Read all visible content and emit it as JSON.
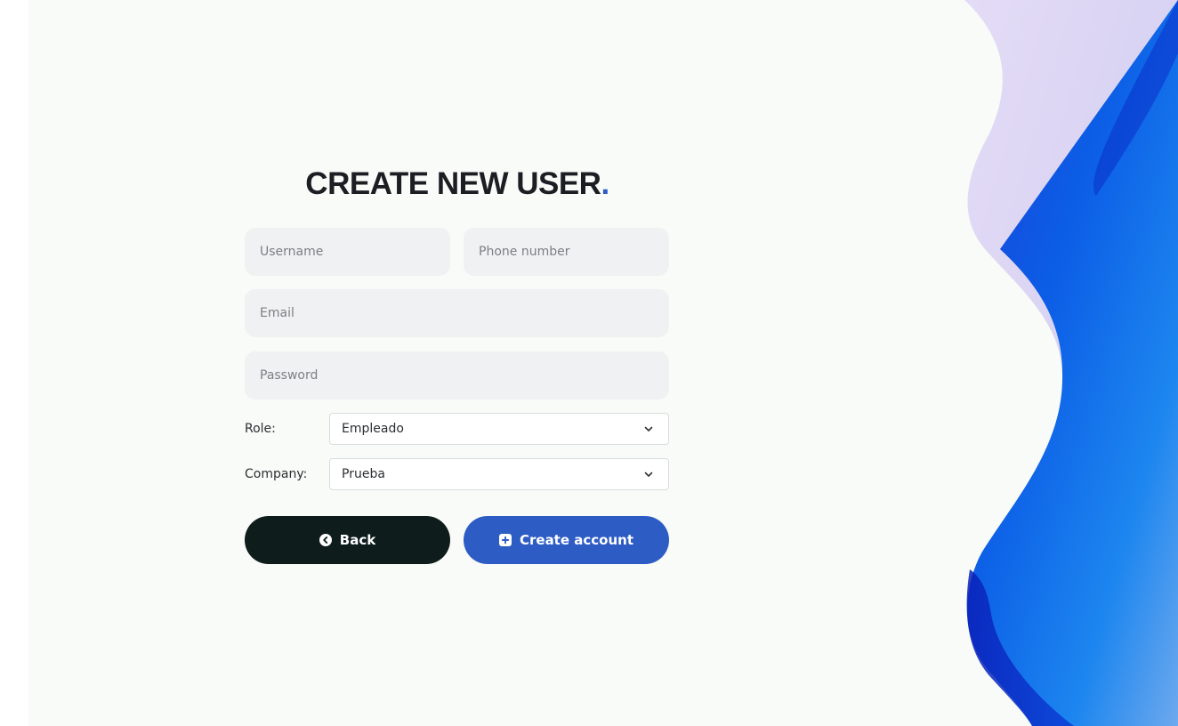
{
  "form": {
    "title": "CREATE NEW USER",
    "title_dot": ".",
    "username_placeholder": "Username",
    "phone_placeholder": "Phone number",
    "email_placeholder": "Email",
    "password_placeholder": "Password",
    "role_label": "Role:",
    "role_value": "Empleado",
    "company_label": "Company:",
    "company_value": "Prueba",
    "back_label": "Back",
    "create_label": "Create account"
  },
  "colors": {
    "accent": "#2d5cc5",
    "dark_button": "#0f1c1c",
    "background": "#f9fbf8",
    "field_bg": "#f0f1f2"
  },
  "icons": {
    "back": "chevron-left-circle-icon",
    "create": "plus-square-icon",
    "select": "chevron-down-icon"
  }
}
